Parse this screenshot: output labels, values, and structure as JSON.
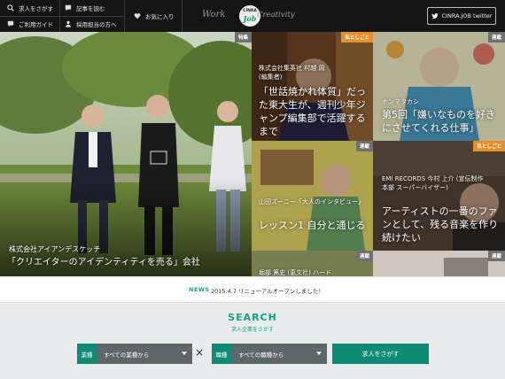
{
  "header": {
    "nav": [
      {
        "label": "求人をさがす",
        "icon": "magnifier-icon"
      },
      {
        "label": "記事を読む",
        "icon": "speech-bubble-icon"
      },
      {
        "label": "お気に入り",
        "icon": "heart-icon"
      },
      {
        "label": "ご利用ガイド",
        "icon": "chat-bubble-icon"
      },
      {
        "label": "採用担当の方へ",
        "icon": "person-icon"
      }
    ],
    "logo": {
      "left_word": "Work",
      "right_word": "Creativity",
      "badge_top": "CINRA",
      "badge_bottom": "Job"
    },
    "twitter_label": "CINRA.JOB twitter"
  },
  "hero": {
    "tag": "特集",
    "subtitle": "株式会社アイアンデスケッチ",
    "title": "「クリエイターのアイデンティティを売る」会社"
  },
  "tiles": [
    {
      "tag": "私としごと",
      "subtitle": "株式会社集英社 村越 周 (編集者)",
      "title": "「世話焼かれ体質」だった東大生が、週刊少年ジャンプ編集部で活躍するまで"
    },
    {
      "tag": "連載",
      "subtitle": "ホンマタカシ",
      "title": "第5回「嫌いなものを好きにさせてくれる仕事」"
    },
    {
      "tag": "連載",
      "subtitle": "山田ズーニー「大人のインタビュー」",
      "title": "レッスン1 自分と通じる"
    },
    {
      "tag": "私としごと",
      "subtitle": "EMI RECORDS 今村 上介 (宣伝制作本部 スーパーバイザー)",
      "title": "アーティストの一番のファンとして、残る音楽を作り続けたい"
    },
    {
      "tag": "連載",
      "subtitle": "堀部 篤史 (恵文社) ハード",
      "title": ""
    },
    {
      "tag": "連載",
      "subtitle": "",
      "title": ""
    }
  ],
  "news": {
    "label": "NEWS",
    "text": "2015.4.7 リニューアルオープンしました！"
  },
  "search": {
    "title": "SEARCH",
    "subtitle": "求人企業をさがす",
    "industry_label": "業種",
    "industry_value": "すべての業種から",
    "times_symbol": "×",
    "job_label": "職種",
    "job_value": "すべての職種から",
    "button_label": "求人をさがす"
  },
  "colors": {
    "accent": "#0f8a73",
    "orange_tag": "#e88f2a",
    "header_bg": "#151515"
  }
}
